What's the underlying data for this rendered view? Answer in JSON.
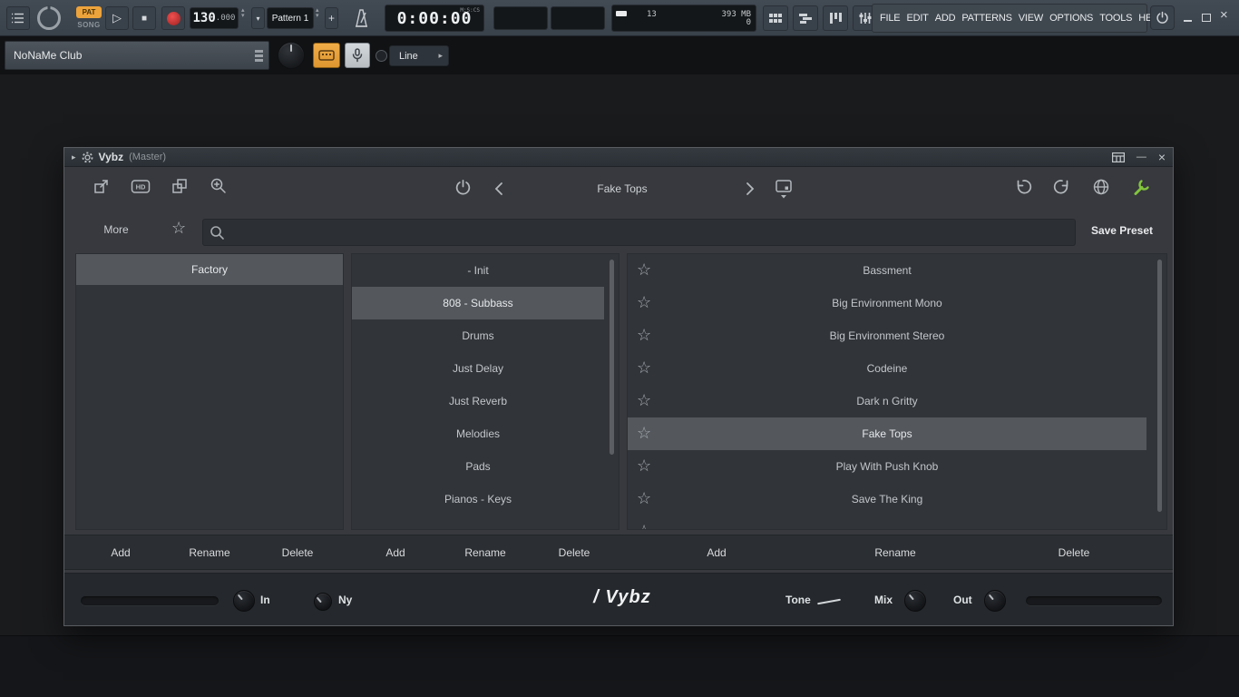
{
  "icons": {
    "star": "☆",
    "play": "▷",
    "stop": "■",
    "plus": "+",
    "up": "▴",
    "down": "▾",
    "right_arrow": "▸",
    "minimize": "—",
    "close": "×"
  },
  "toolbar": {
    "mode_pat": "PAT",
    "mode_song": "SONG",
    "tempo_main": "130",
    "tempo_decimal": ".000",
    "pattern_label": "Pattern 1",
    "time_value": "0:00:00",
    "time_unit": "M:S:CS",
    "cpu_value": "13",
    "mem_value": "393 MB",
    "buffer_value": "0",
    "menu": [
      "FILE",
      "EDIT",
      "ADD",
      "PATTERNS",
      "VIEW",
      "OPTIONS",
      "TOOLS",
      "HELP"
    ]
  },
  "hint_row": {
    "channel_name": "NoNaMe Club",
    "tool_name": "Line"
  },
  "plugin": {
    "title": "Vybz",
    "title_context": "(Master)",
    "preset_name": "Fake Tops",
    "more_label": "More",
    "save_preset_label": "Save Preset",
    "search_value": "",
    "banks": [
      {
        "label": "Factory",
        "selected": true
      }
    ],
    "categories": [
      {
        "label": "- Init",
        "selected": false
      },
      {
        "label": "808 - Subbass",
        "selected": true
      },
      {
        "label": "Drums",
        "selected": false
      },
      {
        "label": "Just Delay",
        "selected": false
      },
      {
        "label": "Just Reverb",
        "selected": false
      },
      {
        "label": "Melodies",
        "selected": false
      },
      {
        "label": "Pads",
        "selected": false
      },
      {
        "label": "Pianos - Keys",
        "selected": false
      }
    ],
    "presets": [
      {
        "label": "Bassment",
        "selected": false
      },
      {
        "label": "Big Environment Mono",
        "selected": false
      },
      {
        "label": "Big Environment Stereo",
        "selected": false
      },
      {
        "label": "Codeine",
        "selected": false
      },
      {
        "label": "Dark n Gritty",
        "selected": false
      },
      {
        "label": "Fake Tops",
        "selected": true
      },
      {
        "label": "Play With Push Knob",
        "selected": false
      },
      {
        "label": "Save The King",
        "selected": false
      }
    ],
    "actions": {
      "add": "Add",
      "rename": "Rename",
      "delete": "Delete"
    },
    "bottom": {
      "in_label": "In",
      "ny_label": "Ny",
      "logo": "/ Vybz",
      "tone_label": "Tone",
      "mix_label": "Mix",
      "out_label": "Out"
    }
  }
}
